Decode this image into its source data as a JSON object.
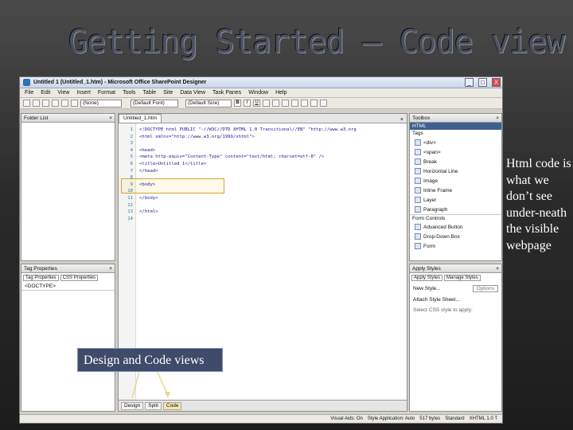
{
  "slide": {
    "title": "Getting Started – Code view",
    "callout": "Design and Code views",
    "side_note": "Html code is what we don’t see under-neath the visible webpage"
  },
  "window": {
    "title": "Untitled 1 (Untitled_1.htm) - Microsoft Office SharePoint Designer",
    "minimize": "_",
    "maximize": "□",
    "close": "X"
  },
  "menu": [
    "File",
    "Edit",
    "View",
    "Insert",
    "Format",
    "Tools",
    "Table",
    "Site",
    "Data View",
    "Task Panes",
    "Window",
    "Help"
  ],
  "toolbar": {
    "style_combo": "(None)",
    "font_combo": "(Default Font)",
    "size_combo": "(Default Size)",
    "bold": "B",
    "italic": "I",
    "underline": "U"
  },
  "panels": {
    "folder_list": "Folder List",
    "tag_properties": "Tag Properties",
    "tag_tabs": [
      "Tag Properties",
      "CSS Properties"
    ],
    "tag_value": "<DOCTYPE>",
    "toolbox": "Toolbox",
    "toolbox_html": "HTML",
    "toolbox_tags": "Tags",
    "toolbox_items": [
      "<div>",
      "<span>",
      "Break",
      "Horizontal Line",
      "Image",
      "Inline Frame",
      "Layer",
      "Paragraph"
    ],
    "form_controls": "Form Controls",
    "form_items": [
      "Advanced Button",
      "Drop-Down Box",
      "Form"
    ],
    "apply_styles": "Apply Styles",
    "apply_tabs": [
      "Apply Styles",
      "Manage Styles"
    ],
    "new_style": "New Style...",
    "options": "Options",
    "attach_sheet": "Attach Style Sheet...",
    "select_css": "Select CSS style to apply:"
  },
  "editor": {
    "tab": "Untitled_1.htm",
    "lines": [
      {
        "n": "1",
        "t": "<!DOCTYPE html PUBLIC \"-//W3C//DTD XHTML 1.0 Transitional//EN\" \"http://www.w3.org"
      },
      {
        "n": "2",
        "t": "<html xmlns=\"http://www.w3.org/1999/xhtml\">"
      },
      {
        "n": "3",
        "t": ""
      },
      {
        "n": "4",
        "t": "<head>"
      },
      {
        "n": "5",
        "t": "<meta http-equiv=\"Content-Type\" content=\"text/html; charset=utf-8\" />"
      },
      {
        "n": "6",
        "t": "<title>Untitled 1</title>"
      },
      {
        "n": "7",
        "t": "</head>"
      },
      {
        "n": "8",
        "t": ""
      },
      {
        "n": "9",
        "t": "<body>"
      },
      {
        "n": "10",
        "t": ""
      },
      {
        "n": "11",
        "t": "</body>"
      },
      {
        "n": "12",
        "t": ""
      },
      {
        "n": "13",
        "t": "</html>"
      },
      {
        "n": "14",
        "t": ""
      }
    ],
    "view_tabs": [
      "Design",
      "Split",
      "Code"
    ]
  },
  "status": {
    "visual_aids": "Visual Aids: On",
    "style_app": "Style Application: Auto",
    "size": "517 bytes",
    "mode": "Standard",
    "dims": "XHTML 1.0 T"
  }
}
